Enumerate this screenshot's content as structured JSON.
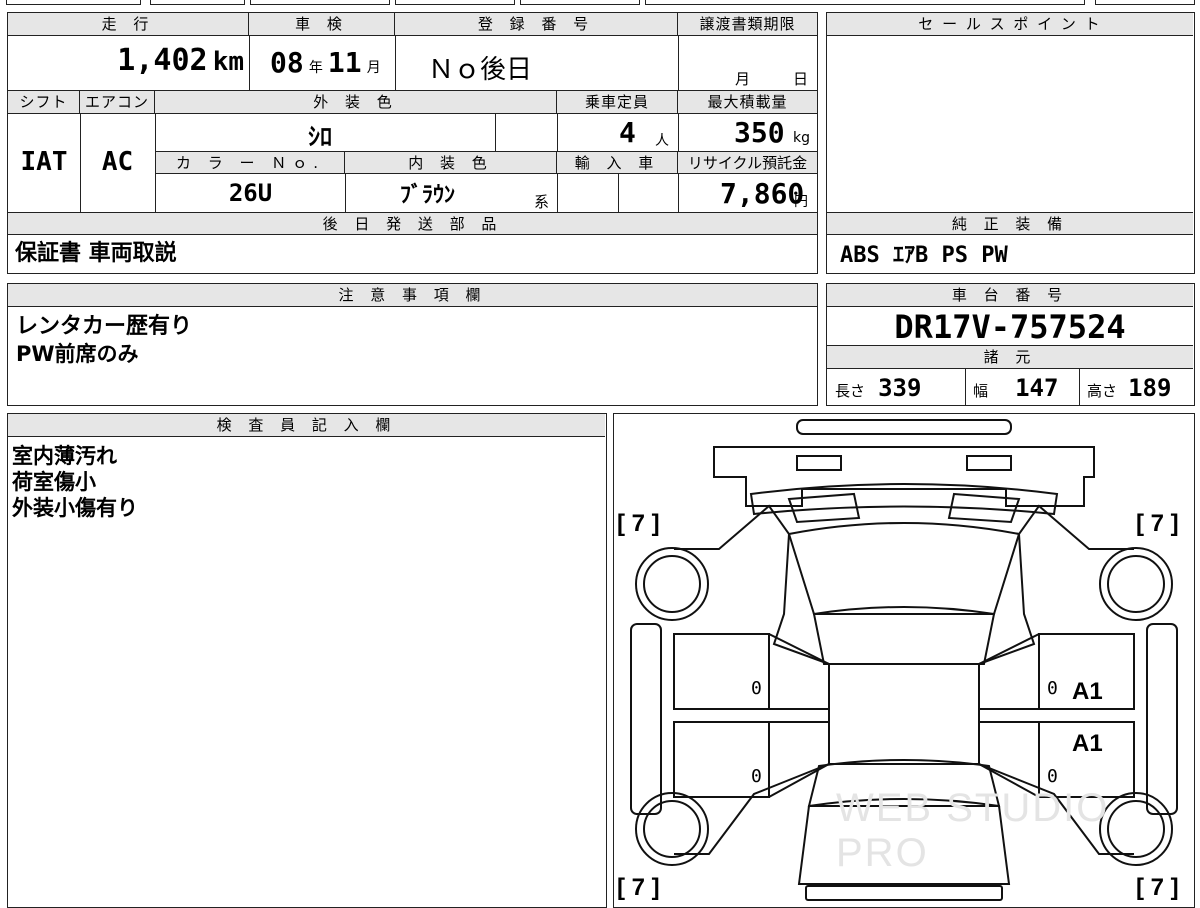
{
  "top_strip": {
    "fragment": "━ ━ ━"
  },
  "mileage": {
    "label": "走 行",
    "value": "1,402",
    "unit": "km"
  },
  "inspection": {
    "label": "車 検",
    "year": "08",
    "year_unit": "年",
    "month": "11",
    "month_unit": "月"
  },
  "registration": {
    "label": "登 録 番 号",
    "value": "Ｎｏ後日"
  },
  "transfer_deadline": {
    "label": "譲渡書類期限",
    "month_unit": "月",
    "day_unit": "日"
  },
  "sales_point": {
    "label": "セ ー ル ス ポ イ ン ト",
    "value": ""
  },
  "shift": {
    "label": "シフト",
    "value": "IAT"
  },
  "aircon": {
    "label": "エアコン",
    "value": "AC"
  },
  "exterior_color": {
    "label": "外 装 色",
    "value": "ｼﾛ"
  },
  "capacity": {
    "label": "乗車定員",
    "value": "4",
    "unit": "人"
  },
  "max_load": {
    "label": "最大積載量",
    "value": "350",
    "unit": "kg"
  },
  "color_no": {
    "label": "カ ラ ー Ｎｏ.",
    "value": "26U"
  },
  "interior_color": {
    "label": "内 装 色",
    "value": "ﾌﾞﾗｳﾝ",
    "suffix": "系"
  },
  "import": {
    "label": "輸 入 車"
  },
  "recycle_fee": {
    "label": "リサイクル預託金",
    "value": "7,860",
    "unit": "円"
  },
  "later_parts": {
    "label": "後 日 発 送 部 品",
    "value": "保証書 車両取説"
  },
  "genuine_equipment": {
    "label": "純 正 装 備",
    "value": "ABS ｴｱB PS PW"
  },
  "notes": {
    "label": "注 意 事 項 欄",
    "lines": [
      "レンタカー歴有り",
      "PW前席のみ"
    ]
  },
  "chassis": {
    "label": "車 台 番 号",
    "value": "DR17V-757524"
  },
  "specs": {
    "label": "諸 元",
    "length_label": "長さ",
    "length": "339",
    "width_label": "幅",
    "width": "147",
    "height_label": "高さ",
    "height": "189"
  },
  "inspector": {
    "label": "検 査 員 記 入 欄",
    "lines": [
      "室内薄汚れ",
      "荷室傷小",
      "外装小傷有り"
    ]
  },
  "diagram": {
    "tire_marks": [
      "[ 7 ]",
      "[ 7 ]",
      "[ 7 ]",
      "[ 7 ]"
    ],
    "door_zeros": [
      "0",
      "0",
      "0",
      "0"
    ],
    "damage_marks": [
      "A1",
      "A1"
    ],
    "watermark": "WEB STUDIO PRO"
  }
}
